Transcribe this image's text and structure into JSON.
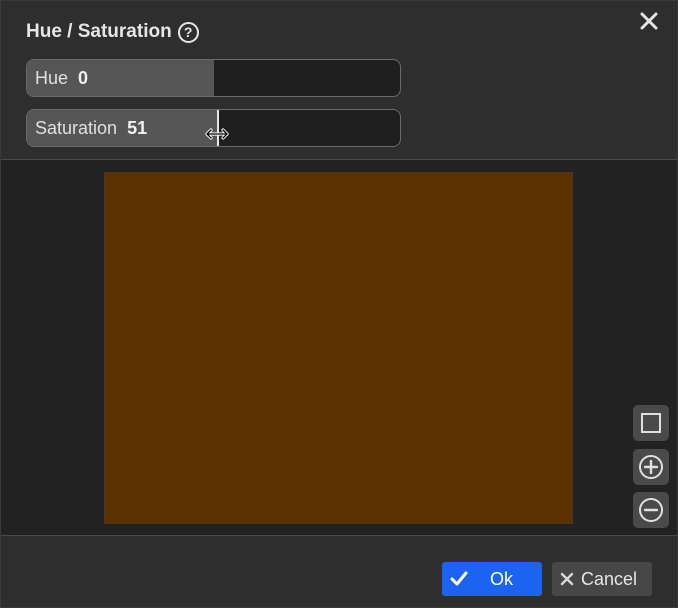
{
  "dialog": {
    "title": "Hue / Saturation",
    "help_icon": "question-circle-icon",
    "close_icon": "close-icon"
  },
  "sliders": {
    "hue": {
      "label": "Hue",
      "value": "0",
      "fill_fraction": 0.5
    },
    "saturation": {
      "label": "Saturation",
      "value": "51",
      "fill_fraction": 0.51
    }
  },
  "preview": {
    "color": "#5c3100"
  },
  "zoom_controls": {
    "fit_icon": "square-icon",
    "zoom_in_icon": "zoom-in-icon",
    "zoom_out_icon": "zoom-out-icon"
  },
  "footer": {
    "ok_label": "Ok",
    "cancel_label": "Cancel",
    "ok_icon": "checkmark-icon",
    "cancel_icon": "x-icon"
  },
  "colors": {
    "accent": "#1d63f2",
    "background": "#2e2e2e"
  }
}
